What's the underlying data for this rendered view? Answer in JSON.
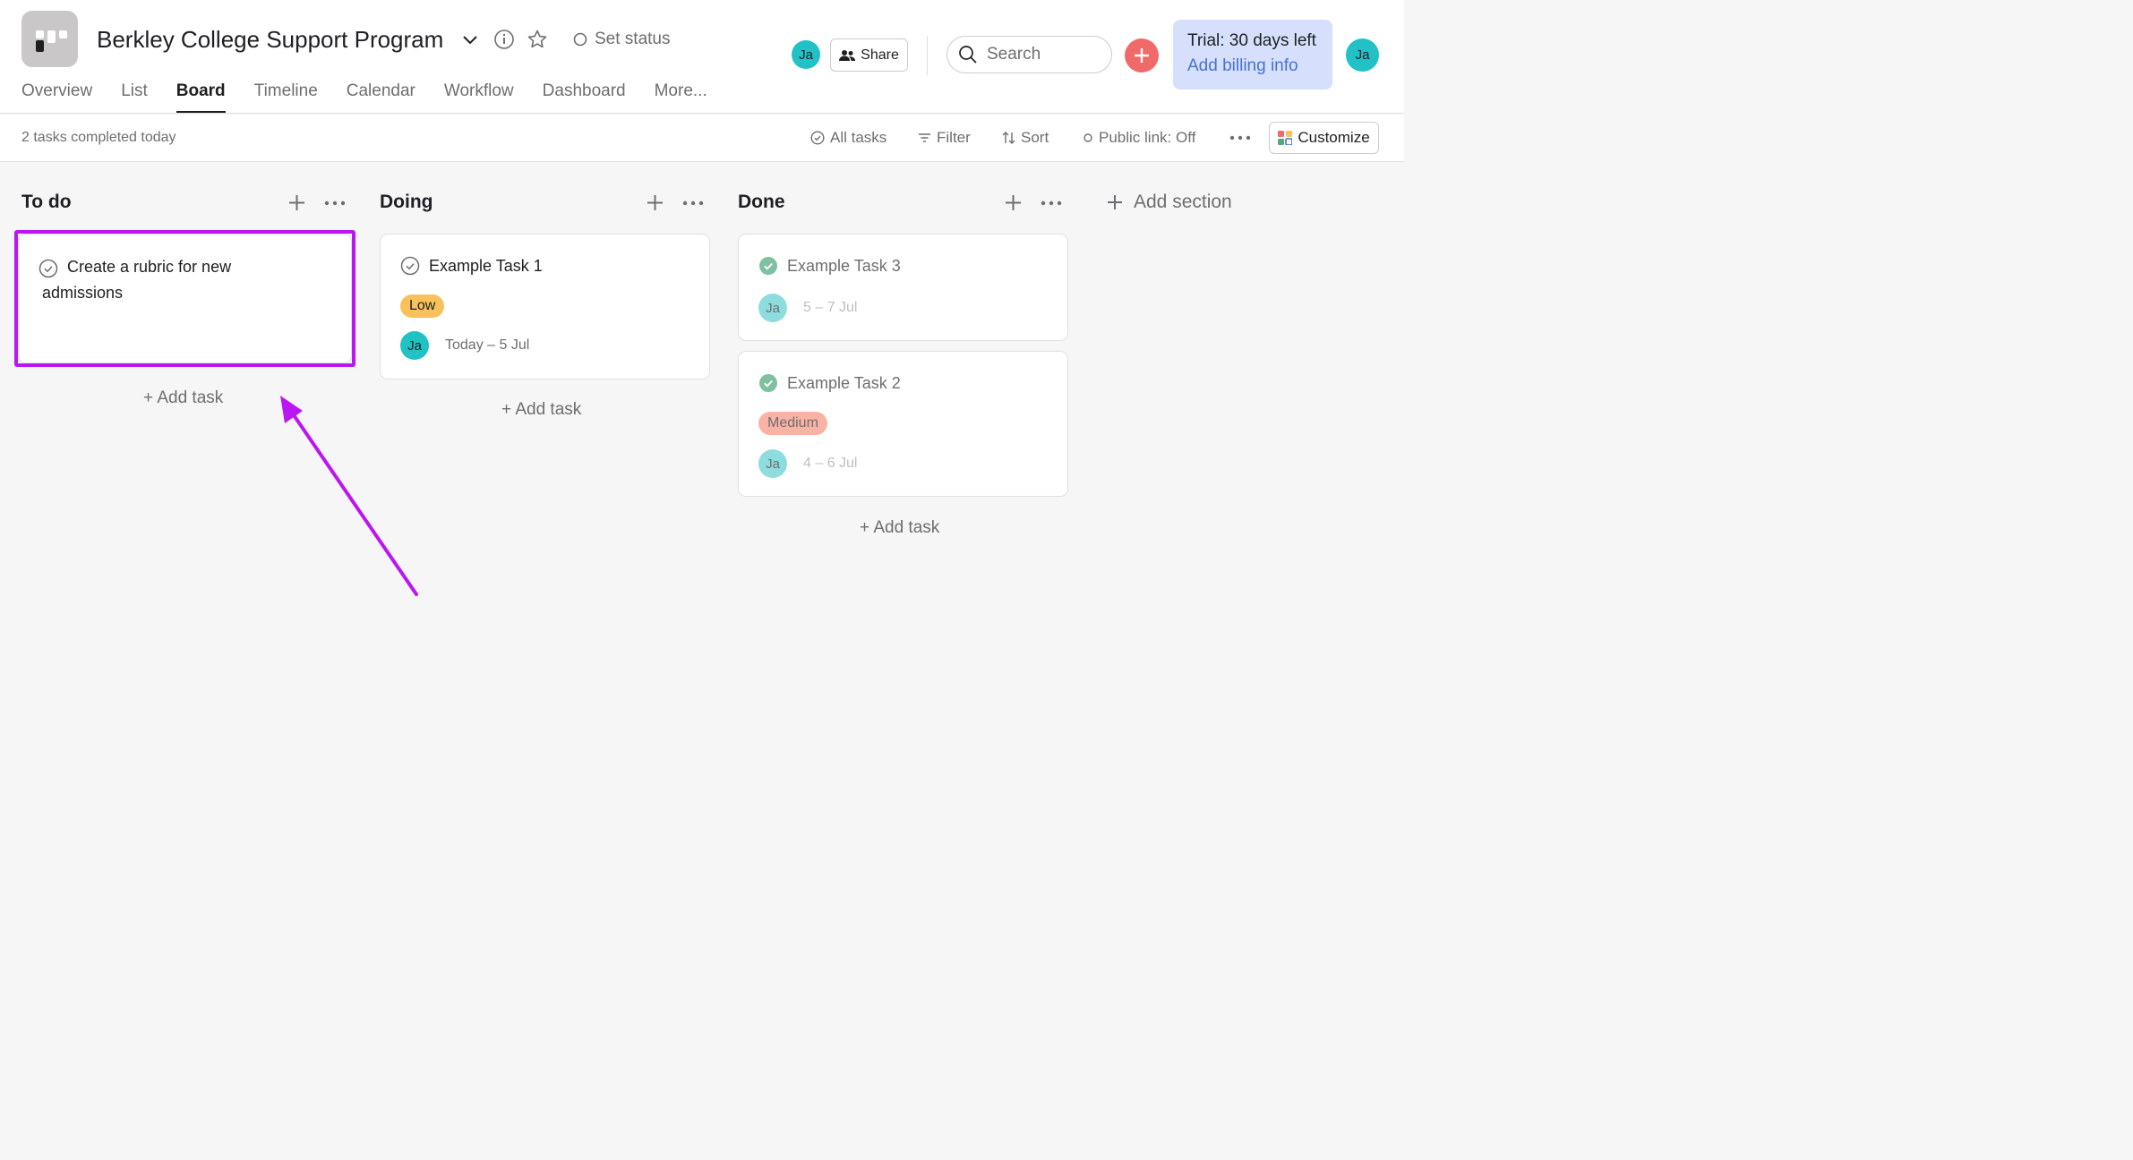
{
  "project": {
    "title": "Berkley College Support Program",
    "set_status": "Set status"
  },
  "tabs": [
    "Overview",
    "List",
    "Board",
    "Timeline",
    "Calendar",
    "Workflow",
    "Dashboard",
    "More..."
  ],
  "active_tab": "Board",
  "header": {
    "avatar_initials": "Ja",
    "share_label": "Share",
    "search_placeholder": "Search",
    "trial_text": "Trial: 30 days left",
    "billing_link": "Add billing info",
    "user_initials": "Ja"
  },
  "subbar": {
    "completed_text": "2 tasks completed today",
    "all_tasks": "All tasks",
    "filter": "Filter",
    "sort": "Sort",
    "public_link": "Public link: Off",
    "customize": "Customize"
  },
  "columns": [
    {
      "name": "To do",
      "add_task": "+ Add task"
    },
    {
      "name": "Doing",
      "add_task": "+ Add task"
    },
    {
      "name": "Done",
      "add_task": "+ Add task"
    }
  ],
  "add_section": "Add section",
  "cards": {
    "todo_1": {
      "title_line1": "Create a rubric for new",
      "title_line2": "admissions"
    },
    "doing_1": {
      "title": "Example Task 1",
      "priority": "Low",
      "assignee": "Ja",
      "dates": "Today – 5 Jul"
    },
    "done_1": {
      "title": "Example Task 3",
      "assignee": "Ja",
      "dates": "5 – 7 Jul"
    },
    "done_2": {
      "title": "Example Task 2",
      "priority": "Medium",
      "assignee": "Ja",
      "dates": "4 – 6 Jul"
    }
  },
  "colors": {
    "accent_annotation": "#bb16f2",
    "low_priority": "#f8c15c",
    "medium_priority": "#f9b3a5",
    "avatar": "#20c2c6",
    "trial_bg": "#d6e0fc",
    "plus_button": "#f06a6a",
    "complete_check": "#58a182"
  }
}
